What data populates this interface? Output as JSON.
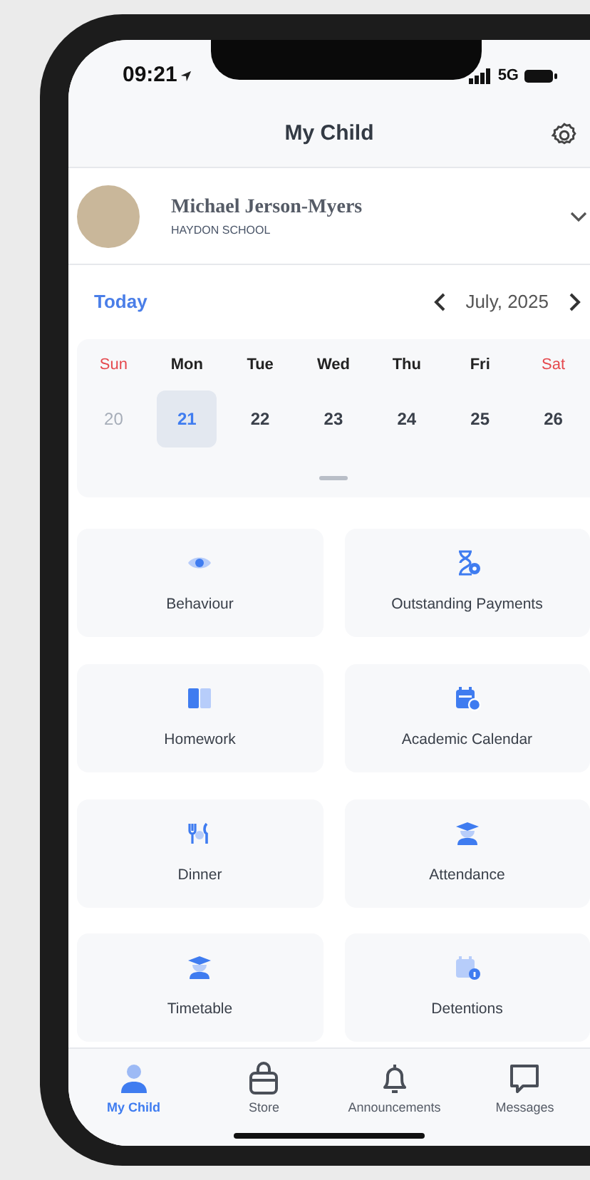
{
  "status_bar": {
    "time": "09:21",
    "network": "5G"
  },
  "header": {
    "title": "My Child"
  },
  "child": {
    "name": "Michael Jerson-Myers",
    "school": "HAYDON SCHOOL"
  },
  "calendar": {
    "today_label": "Today",
    "month": "July, 2025",
    "weekdays": [
      {
        "label": "Sun",
        "weekend": true
      },
      {
        "label": "Mon",
        "weekend": false
      },
      {
        "label": "Tue",
        "weekend": false
      },
      {
        "label": "Wed",
        "weekend": false
      },
      {
        "label": "Thu",
        "weekend": false
      },
      {
        "label": "Fri",
        "weekend": false
      },
      {
        "label": "Sat",
        "weekend": true
      }
    ],
    "dates": [
      {
        "label": "20",
        "selected": false,
        "muted": true
      },
      {
        "label": "21",
        "selected": true,
        "muted": false
      },
      {
        "label": "22",
        "selected": false,
        "muted": false
      },
      {
        "label": "23",
        "selected": false,
        "muted": false
      },
      {
        "label": "24",
        "selected": false,
        "muted": false
      },
      {
        "label": "25",
        "selected": false,
        "muted": false
      },
      {
        "label": "26",
        "selected": false,
        "muted": false
      }
    ]
  },
  "tiles": [
    {
      "label": "Behaviour",
      "kind": "eye"
    },
    {
      "label": "Outstanding Payments",
      "kind": "hourglass"
    },
    {
      "label": "Homework",
      "kind": "book"
    },
    {
      "label": "Academic Calendar",
      "kind": "calendar"
    },
    {
      "label": "Dinner",
      "kind": "cutlery"
    },
    {
      "label": "Attendance",
      "kind": "graduate"
    },
    {
      "label": "Timetable",
      "kind": "graduate"
    },
    {
      "label": "Detentions",
      "kind": "calendar-info"
    }
  ],
  "tab_bar": [
    {
      "label": "My Child",
      "kind": "person",
      "selected": true
    },
    {
      "label": "Store",
      "kind": "bag",
      "selected": false
    },
    {
      "label": "Announcements",
      "kind": "bell",
      "selected": false
    },
    {
      "label": "Messages",
      "kind": "chat",
      "selected": false
    }
  ]
}
